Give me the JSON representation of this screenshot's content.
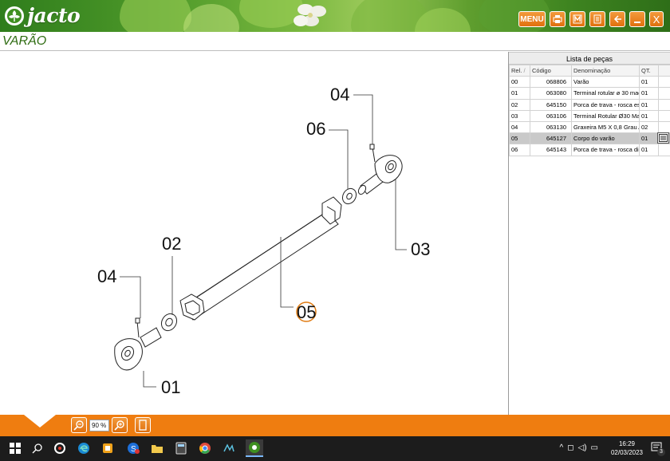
{
  "app": {
    "logo_text": "jacto",
    "title": "VARÃO"
  },
  "toolbar": {
    "menu_label": "MENU",
    "close_label": "X",
    "buttons": [
      "print-icon",
      "letter-m-icon",
      "document-icon",
      "back-arrow-icon",
      "minimize-icon",
      "close-icon"
    ]
  },
  "drawing": {
    "callouts": [
      "04",
      "06",
      "03",
      "02",
      "05",
      "04",
      "01"
    ],
    "highlighted": "05"
  },
  "parts_list": {
    "title": "Lista de peças",
    "columns": [
      "Rel.",
      "Código",
      "Denominação",
      "QT."
    ],
    "sort_indicator": "/",
    "rows": [
      {
        "rel": "00",
        "code": "068806",
        "name": "Varão",
        "qty": "01"
      },
      {
        "rel": "01",
        "code": "063080",
        "name": "Terminal rotular ø 30 mac",
        "qty": "01"
      },
      {
        "rel": "02",
        "code": "645150",
        "name": "Porca de trava - rosca es",
        "qty": "01"
      },
      {
        "rel": "03",
        "code": "063106",
        "name": "Terminal Rotular Ø30 Mac",
        "qty": "01"
      },
      {
        "rel": "04",
        "code": "063130",
        "name": "Graxeira M5 X 0,8 Grau A",
        "qty": "02"
      },
      {
        "rel": "05",
        "code": "645127",
        "name": "Corpo do varão",
        "qty": "01"
      },
      {
        "rel": "06",
        "code": "645143",
        "name": "Porca de trava - rosca di",
        "qty": "01"
      }
    ],
    "selected_index": 5
  },
  "zoom": {
    "value": "90 %"
  },
  "taskbar": {
    "apps": [
      "windows-start-icon",
      "search-icon",
      "chrome-like-icon",
      "edge-icon",
      "outlook-icon",
      "skype-icon",
      "file-explorer-icon",
      "calculator-icon",
      "chrome-icon",
      "app-icon",
      "jacto-app-icon"
    ],
    "time": "16:29",
    "date": "02/03/2023",
    "notification_count": "3"
  }
}
